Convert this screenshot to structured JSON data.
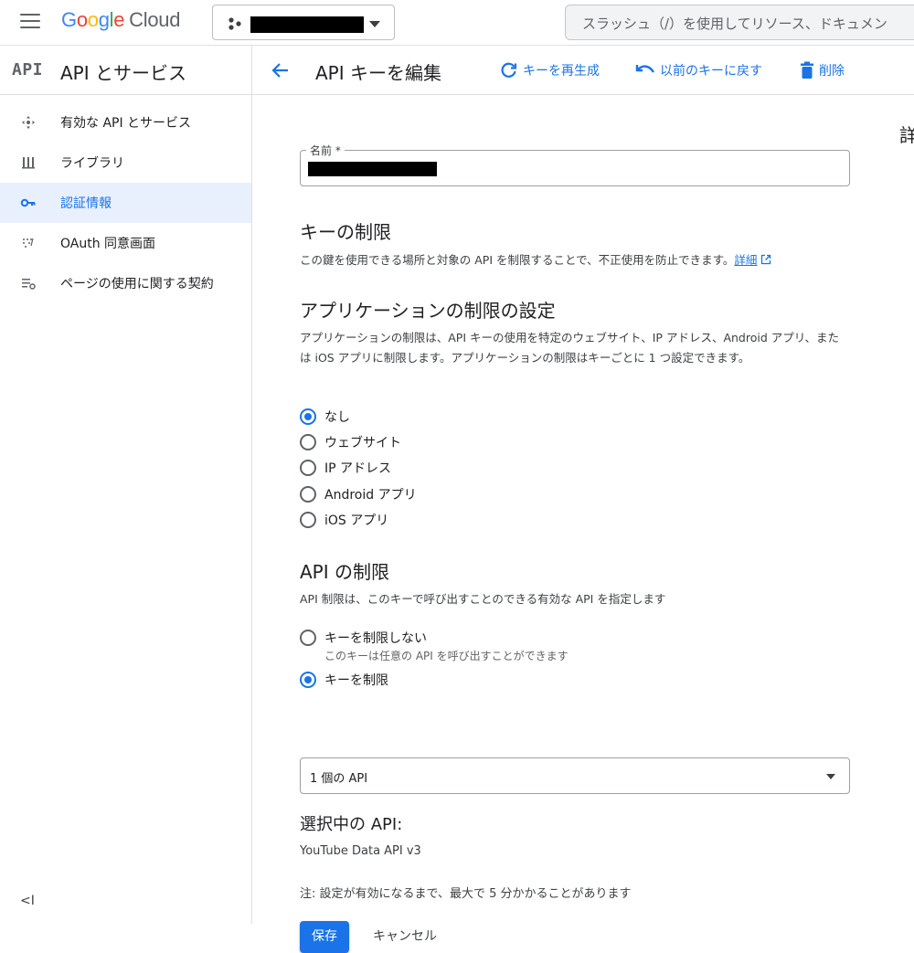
{
  "header": {
    "logo_google": "Google",
    "logo_cloud": "Cloud",
    "search_placeholder": "スラッシュ（/）を使用してリソース、ドキュメン"
  },
  "sidebar": {
    "mark": "API",
    "title": "API とサービス",
    "items": [
      {
        "label": "有効な API とサービス",
        "icon": "api-services-icon"
      },
      {
        "label": "ライブラリ",
        "icon": "library-icon"
      },
      {
        "label": "認証情報",
        "icon": "key-icon",
        "active": true
      },
      {
        "label": "OAuth 同意画面",
        "icon": "oauth-consent-icon"
      },
      {
        "label": "ページの使用に関する契約",
        "icon": "page-agreement-icon"
      }
    ],
    "collapse_label": "<I"
  },
  "actionbar": {
    "title": "API キーを編集",
    "regenerate": "キーを再生成",
    "revert": "以前のキーに戻す",
    "delete": "削除",
    "side_cut_text": "詳"
  },
  "form": {
    "name_label": "名前 *",
    "key_restrictions_title": "キーの制限",
    "key_restrictions_desc": "この鍵を使用できる場所と対象の API を制限することで、不正使用を防止できます。",
    "details_link": "詳細",
    "app_restrictions_title": "アプリケーションの制限の設定",
    "app_restrictions_desc": "アプリケーションの制限は、API キーの使用を特定のウェブサイト、IP アドレス、Android アプリ、または iOS アプリに制限します。アプリケーションの制限はキーごとに 1 つ設定できます。",
    "app_options": [
      {
        "label": "なし",
        "selected": true
      },
      {
        "label": "ウェブサイト",
        "selected": false
      },
      {
        "label": "IP アドレス",
        "selected": false
      },
      {
        "label": "Android アプリ",
        "selected": false
      },
      {
        "label": "iOS アプリ",
        "selected": false
      }
    ],
    "api_restrictions_title": "API の制限",
    "api_restrictions_desc": "API 制限は、このキーで呼び出すことのできる有効な API を指定します",
    "api_options": [
      {
        "label": "キーを制限しない",
        "sub": "このキーは任意の API を呼び出すことができます",
        "selected": false
      },
      {
        "label": "キーを制限",
        "sub": "",
        "selected": true
      }
    ],
    "api_select_value": "1 個の API",
    "selected_api_title": "選択中の API:",
    "selected_api": "YouTube Data API v3",
    "note": "注: 設定が有効になるまで、最大で 5 分かかることがあります",
    "save": "保存",
    "cancel": "キャンセル"
  },
  "colors": {
    "accent": "#1a73e8",
    "active_bg": "#e8f0fe"
  }
}
